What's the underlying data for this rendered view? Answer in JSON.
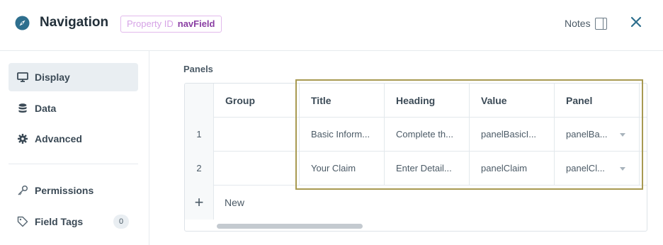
{
  "header": {
    "title": "Navigation",
    "property_id_label": "Property ID",
    "property_id_value": "navField",
    "notes_label": "Notes"
  },
  "sidebar": {
    "items": [
      {
        "label": "Display",
        "icon": "monitor-icon",
        "active": true
      },
      {
        "label": "Data",
        "icon": "database-icon"
      },
      {
        "label": "Advanced",
        "icon": "gear-icon"
      },
      {
        "label": "Permissions",
        "icon": "key-icon"
      },
      {
        "label": "Field Tags",
        "icon": "tag-icon",
        "count": "0"
      }
    ]
  },
  "panels": {
    "label": "Panels",
    "columns": [
      "Group",
      "Title",
      "Heading",
      "Value",
      "Panel"
    ],
    "rows": [
      {
        "index": "1",
        "group": "",
        "title": "Basic Inform...",
        "heading": "Complete th...",
        "value": "panelBasicI...",
        "panel": "panelBa..."
      },
      {
        "index": "2",
        "group": "",
        "title": "Your Claim",
        "heading": "Enter Detail...",
        "value": "panelClaim",
        "panel": "panelCl..."
      }
    ],
    "new_label": "New"
  },
  "colors": {
    "accent": "#2e6f8e",
    "badge_border": "#e2b9ec",
    "badge_value": "#8a3fa3",
    "highlight": "#a89a52"
  }
}
